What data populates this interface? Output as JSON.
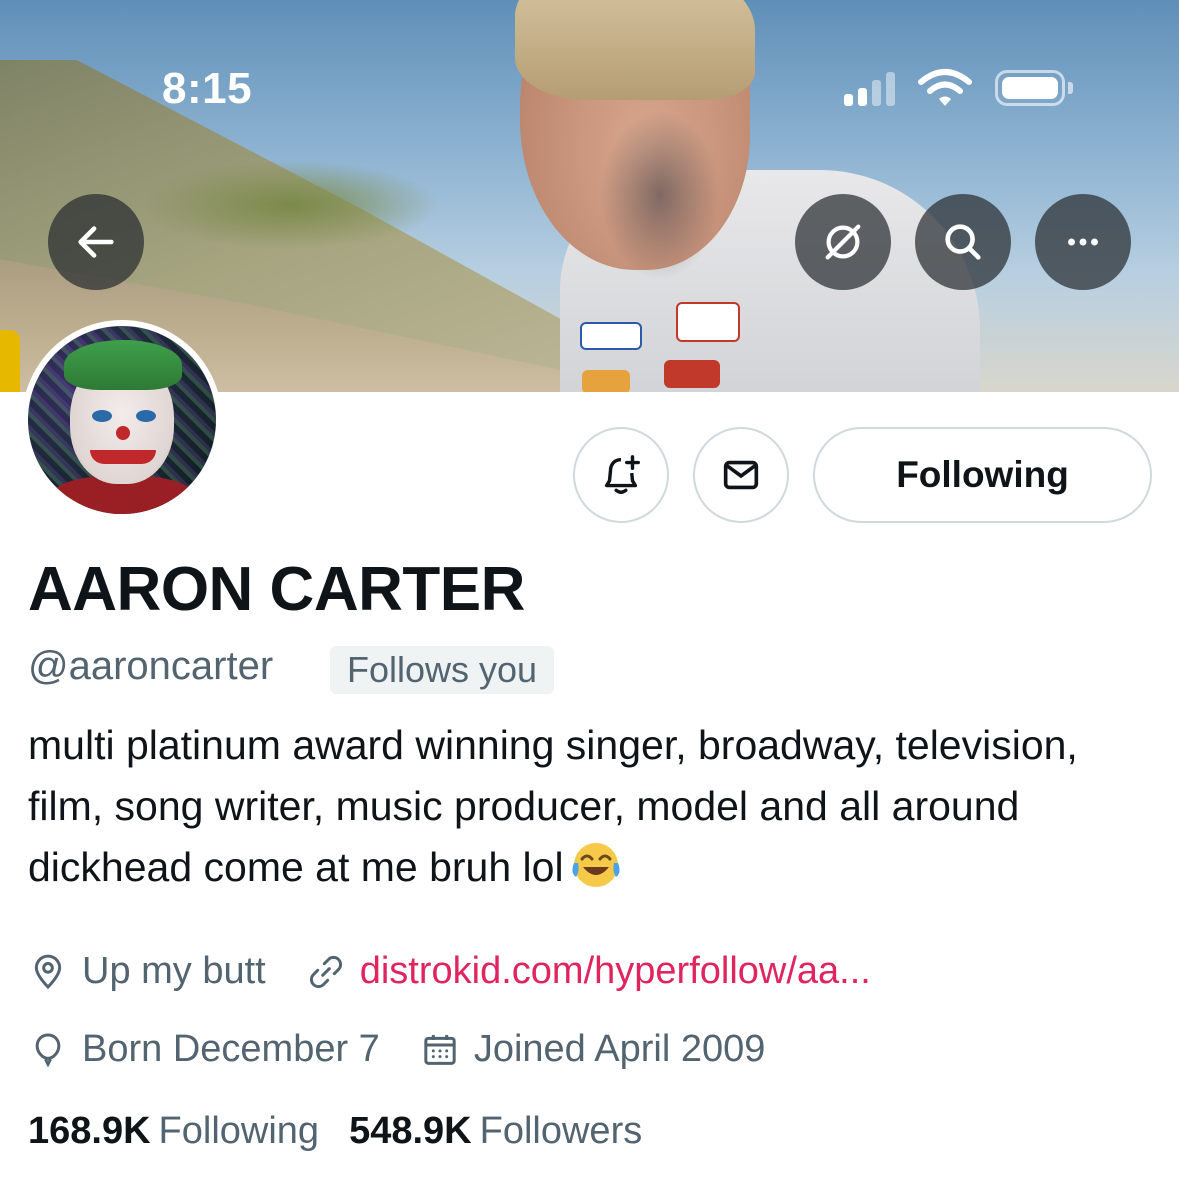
{
  "status_bar": {
    "time": "8:15"
  },
  "header": {
    "back_icon": "arrow-left-icon",
    "actions": [
      "circle-slash-icon",
      "search-icon",
      "more-icon"
    ]
  },
  "profile": {
    "display_name": "AARON CARTER",
    "handle": "@aaroncarter",
    "follows_you_badge": "Follows you",
    "bio": "multi platinum award winning singer, broadway, television, film, song writer, music producer, model and all around dickhead come at me bruh lol",
    "bio_emoji": "face-with-tears-of-joy",
    "location": "Up my butt",
    "website": "distrokid.com/hyperfollow/aa...",
    "birthday": "Born December 7",
    "joined": "Joined April 2009",
    "following_count": "168.9K",
    "following_label": "Following",
    "followers_count": "548.9K",
    "followers_label": "Followers"
  },
  "buttons": {
    "notify_icon": "bell-plus-icon",
    "message_icon": "envelope-icon",
    "following_label": "Following"
  },
  "colors": {
    "text_primary": "#0f1419",
    "text_secondary": "#536471",
    "link": "#e0245e",
    "border": "#cfd9de"
  }
}
